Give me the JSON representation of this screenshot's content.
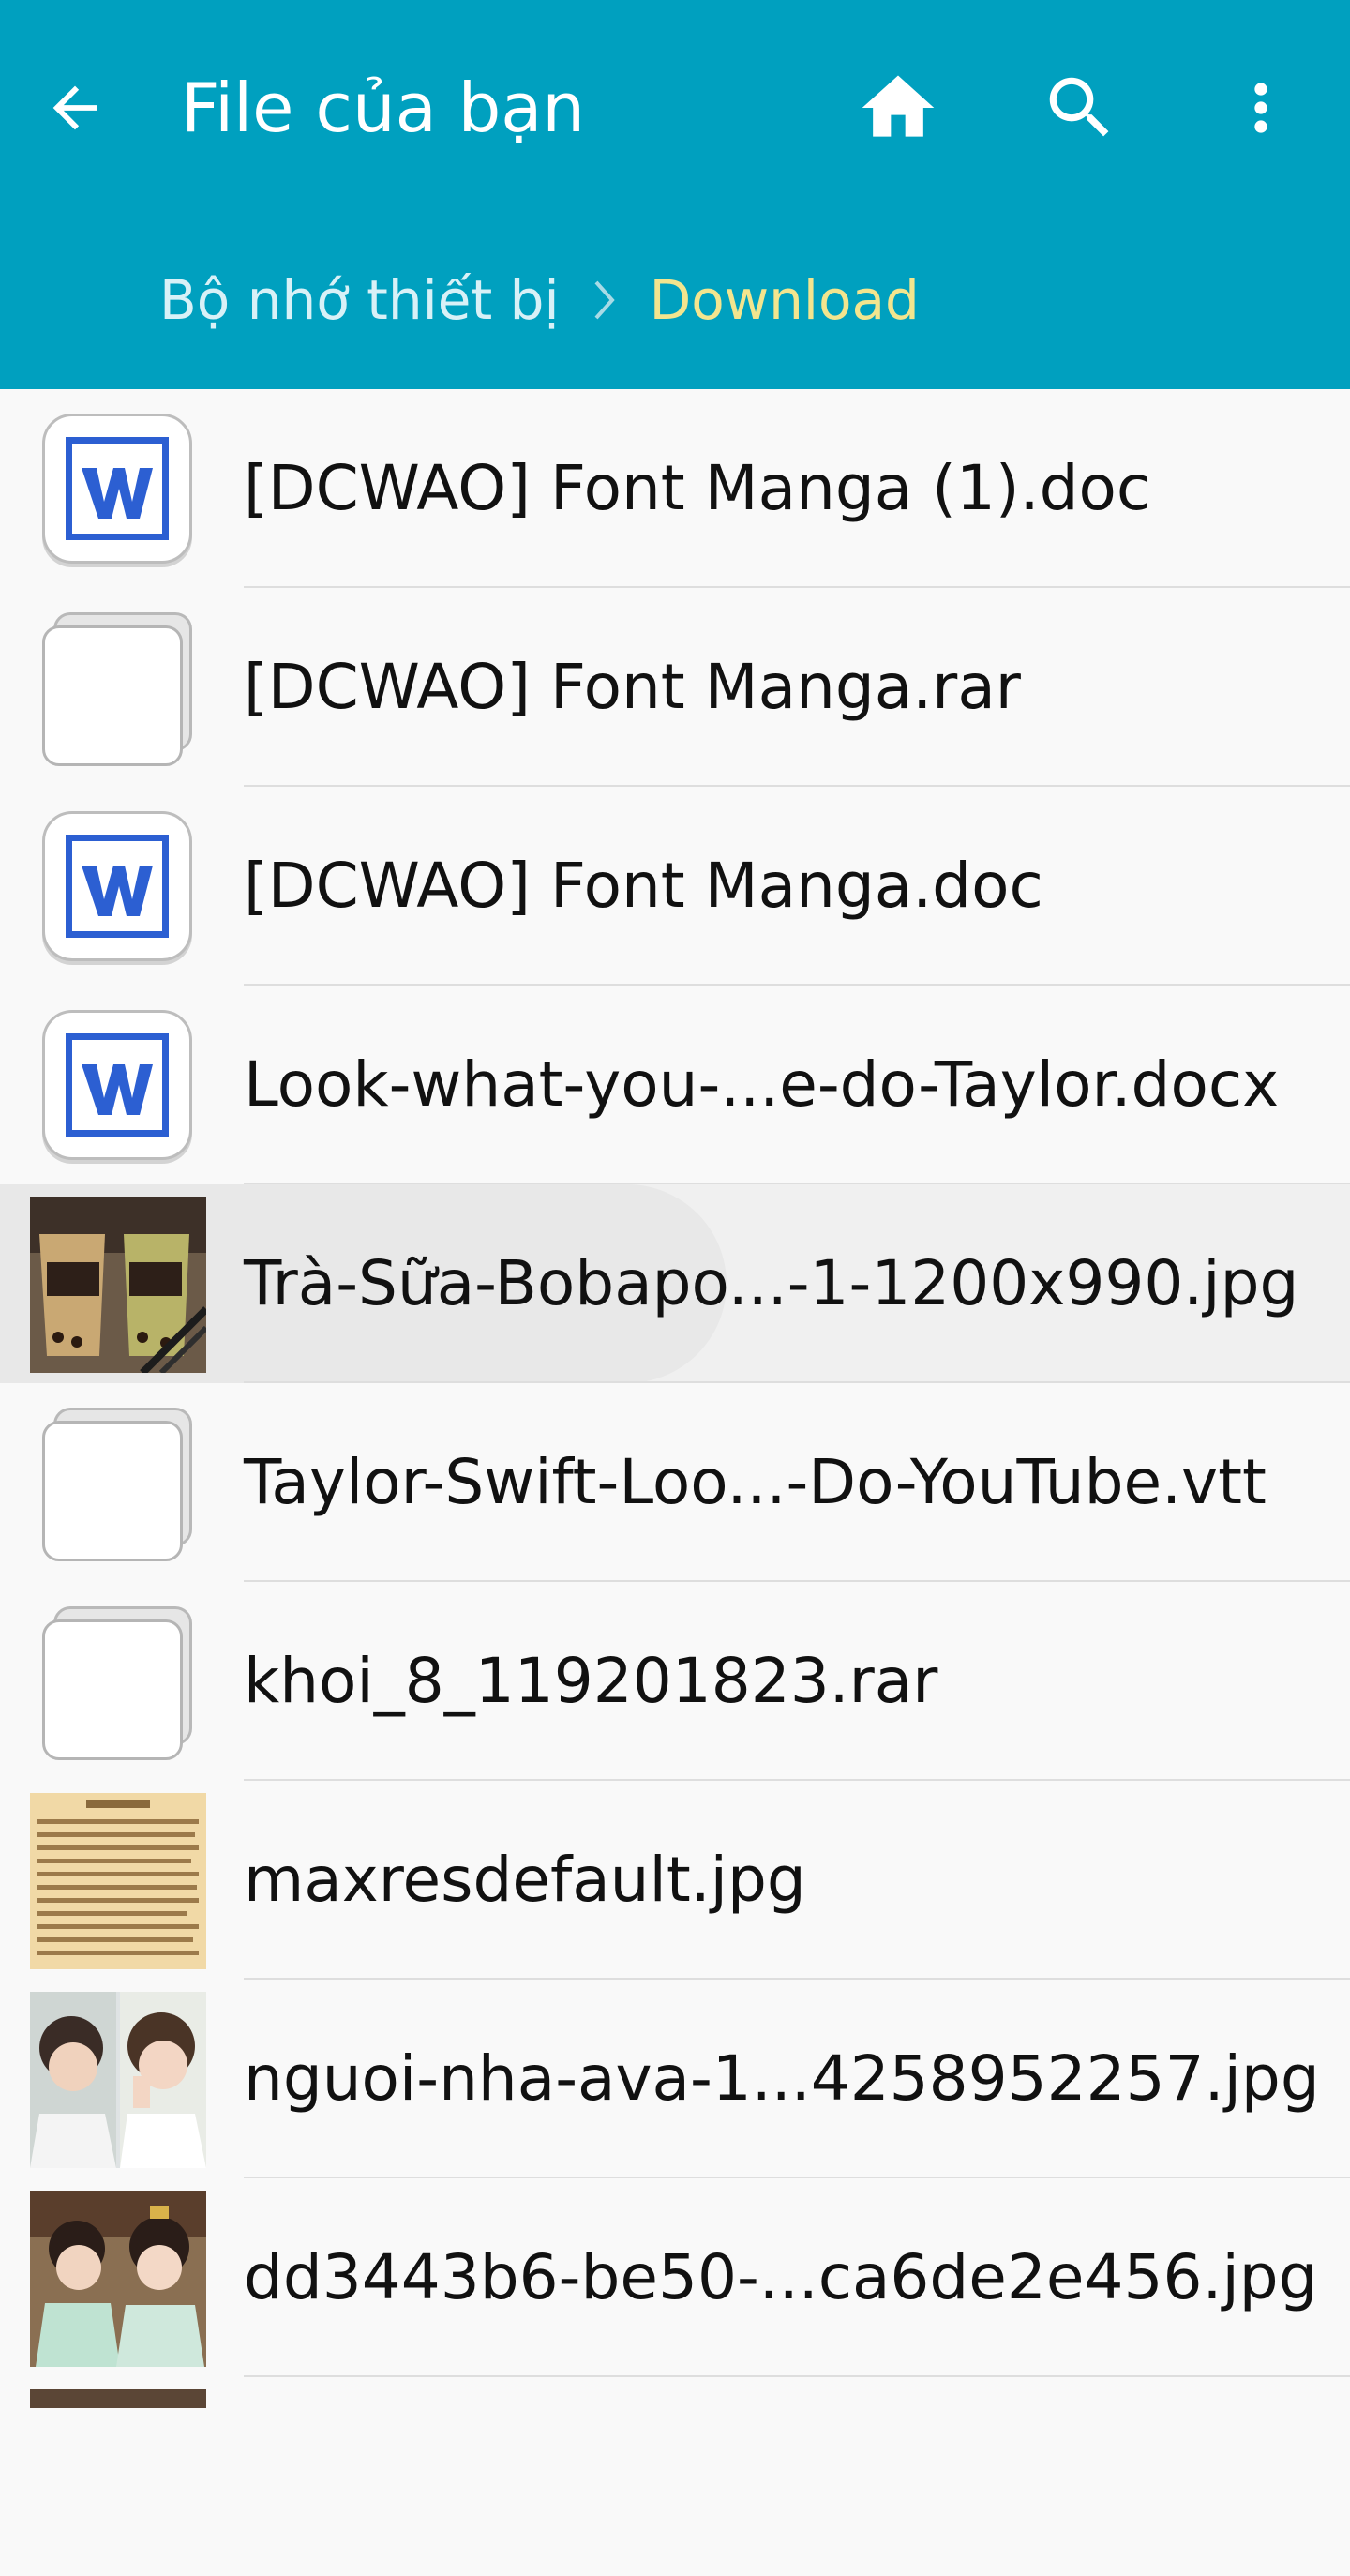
{
  "header": {
    "title": "File của bạn",
    "back_icon": "arrow-left-icon",
    "actions": [
      "home-icon",
      "search-icon",
      "more-vert-icon"
    ]
  },
  "breadcrumb": {
    "items": [
      "Bộ nhớ thiết bị",
      "Download"
    ],
    "separator_icon": "chevron-right-icon"
  },
  "colors": {
    "appbar": "#00a0bf",
    "title": "#ffffff",
    "breadcrumb_current": "#f3e58e",
    "word_icon": "#2c5fd2"
  },
  "files": [
    {
      "name": "[DCWAO] Font Manga (1).doc",
      "icon": "word-doc-icon"
    },
    {
      "name": "[DCWAO] Font Manga.rar",
      "icon": "generic-file-icon"
    },
    {
      "name": "[DCWAO] Font Manga.doc",
      "icon": "word-doc-icon"
    },
    {
      "name": "Look-what-you-...e-do-Taylor.docx",
      "icon": "word-doc-icon"
    },
    {
      "name": "Trà-Sữa-Bobapo...-1-1200x990.jpg",
      "icon": "image-thumbnail"
    },
    {
      "name": "Taylor-Swift-Loo...-Do-YouTube.vtt",
      "icon": "generic-file-icon"
    },
    {
      "name": "khoi_8_119201823.rar",
      "icon": "generic-file-icon"
    },
    {
      "name": "maxresdefault.jpg",
      "icon": "image-thumbnail"
    },
    {
      "name": "nguoi-nha-ava-1...4258952257.jpg",
      "icon": "image-thumbnail"
    },
    {
      "name": "dd3443b6-be50-...ca6de2e456.jpg",
      "icon": "image-thumbnail"
    }
  ]
}
